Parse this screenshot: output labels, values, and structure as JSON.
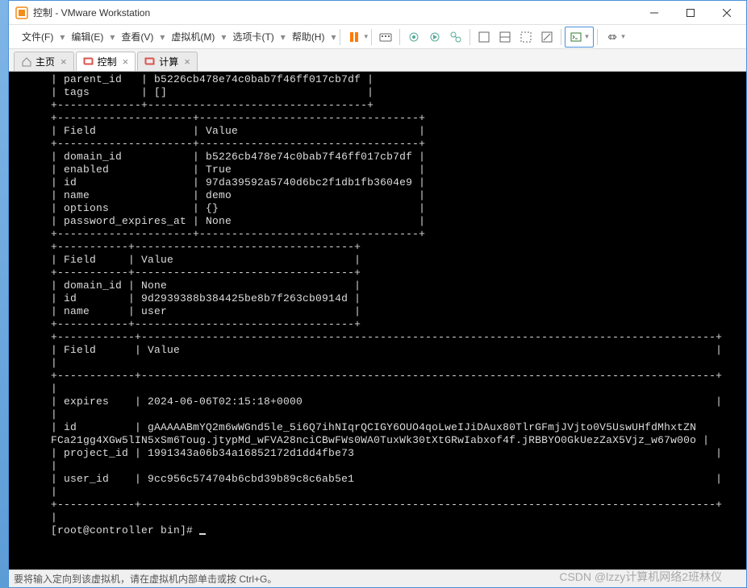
{
  "window": {
    "title": "控制 - VMware Workstation"
  },
  "menu": {
    "file": "文件(F)",
    "edit": "编辑(E)",
    "view": "查看(V)",
    "vm": "虚拟机(M)",
    "tabs": "选项卡(T)",
    "help": "帮助(H)"
  },
  "tabs": {
    "home": "主页",
    "control": "控制",
    "compute": "计算"
  },
  "terminal": {
    "lines": [
      "| parent_id   | b5226cb478e74c0bab7f46ff017cb7df |",
      "| tags        | []                               |",
      "+-------------+----------------------------------+",
      "+---------------------+----------------------------------+",
      "| Field               | Value                            |",
      "+---------------------+----------------------------------+",
      "| domain_id           | b5226cb478e74c0bab7f46ff017cb7df |",
      "| enabled             | True                             |",
      "| id                  | 97da39592a5740d6bc2f1db1fb3604e9 |",
      "| name                | demo                             |",
      "| options             | {}                               |",
      "| password_expires_at | None                             |",
      "+---------------------+----------------------------------+",
      "+-----------+----------------------------------+",
      "| Field     | Value                            |",
      "+-----------+----------------------------------+",
      "| domain_id | None                             |",
      "| id        | 9d2939388b384425be8b7f263cb0914d |",
      "| name      | user                             |",
      "+-----------+----------------------------------+",
      "+------------+-----------------------------------------------------------------------------------------+",
      "| Field      | Value                                                                                   |",
      "|",
      "+------------+-----------------------------------------------------------------------------------------+",
      "|",
      "| expires    | 2024-06-06T02:15:18+0000                                                                |",
      "|",
      "| id         | gAAAAABmYQ2m6wWGnd5le_5i6Q7ihNIqrQCIGY6OUO4qoLweIJiDAux80TlrGFmjJVjto0V5UswUHfdMhxtZN",
      "FCa21gg4XGw5lIN5xSm6Toug.jtypMd_wFVA28nciCBwFWs0WA0TuxWk30tXtGRwIabxof4f.jRBBYO0GkUezZaX5Vjz_w67w00o |",
      "| project_id | 1991343a06b34a16852172d1dd4fbe73                                                        |",
      "|",
      "| user_id    | 9cc956c574704b6cbd39b89c8c6ab5e1                                                        |",
      "|",
      "+------------+-----------------------------------------------------------------------------------------+",
      "|"
    ],
    "prompt": "[root@controller bin]# "
  },
  "status": {
    "hint": "要将输入定向到该虚拟机，请在虚拟机内部单击或按 Ctrl+G。"
  },
  "watermark": "CSDN @lzzy计算机网络2班林仪",
  "colors": {
    "accent": "#ff7a00",
    "border": "#4a90d9"
  }
}
